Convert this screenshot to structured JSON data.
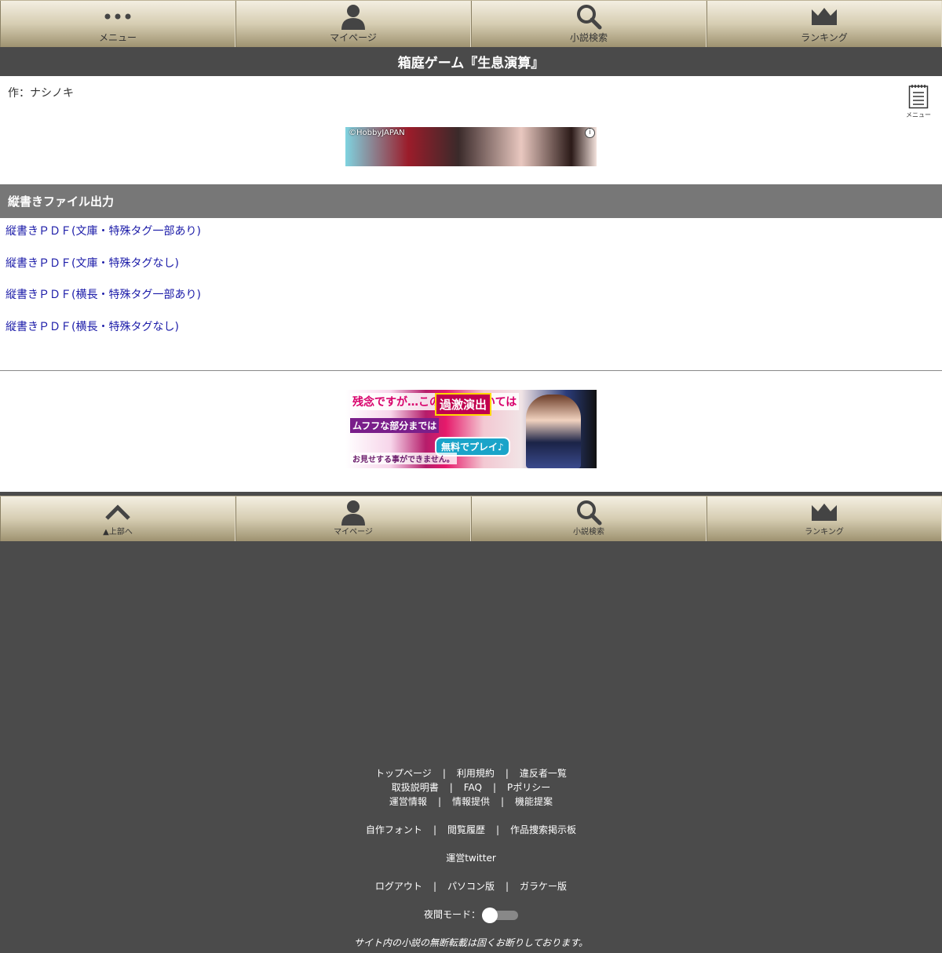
{
  "nav_top": {
    "menu": "メニュー",
    "mypage": "マイページ",
    "search": "小説検索",
    "ranking": "ランキング"
  },
  "novel": {
    "title": "箱庭ゲーム『生息演算』",
    "author": "作：ナシノキ"
  },
  "side_menu_label": "メニュー",
  "ad_top": {
    "credit": "©HobbyJAPAN",
    "info": "i"
  },
  "vertical_section": {
    "header": "縦書きファイル出力",
    "links": [
      "縦書きＰＤＦ(文庫・特殊タグ一部あり)",
      "縦書きＰＤＦ(文庫・特殊タグなし)",
      "縦書きＰＤＦ(横長・特殊タグ一部あり)",
      "縦書きＰＤＦ(横長・特殊タグなし)"
    ]
  },
  "ad_bottom": {
    "t1": "残念ですが…この広告においては",
    "t2": "過激演出",
    "t3": "ムフフな部分までは",
    "t4": "無料でプレイ♪",
    "t5": "お見せする事ができません。"
  },
  "nav_bottom": {
    "top": "▲上部へ",
    "mypage": "マイページ",
    "search": "小説検索",
    "ranking": "ランキング"
  },
  "footer": {
    "row1": [
      "トップページ",
      "利用規約",
      "違反者一覧"
    ],
    "row2": [
      "取扱説明書",
      "FAQ",
      "Pポリシー"
    ],
    "row3": [
      "運営情報",
      "情報提供",
      "機能提案"
    ],
    "row4": [
      "自作フォント",
      "閲覧履歴",
      "作品捜索掲示板"
    ],
    "row5": [
      "運営twitter"
    ],
    "row6": [
      "ログアウト",
      "パソコン版",
      "ガラケー版"
    ],
    "night_mode": "夜間モード：",
    "copyright": "サイト内の小説の無断転載は固くお断りしております。"
  },
  "colors": {
    "nav_gradient_top": "#f4efe2",
    "nav_gradient_bottom": "#9e9270",
    "title_bar": "#4a4a4a",
    "section_header": "#777777",
    "link": "#1a1aa8",
    "footer_bg": "#4b4b4b"
  },
  "icons": {
    "menu": "dots-icon",
    "mypage": "user-icon",
    "search": "search-icon",
    "ranking": "crown-icon",
    "top": "chevron-up-icon",
    "side_menu": "notepad-icon"
  }
}
